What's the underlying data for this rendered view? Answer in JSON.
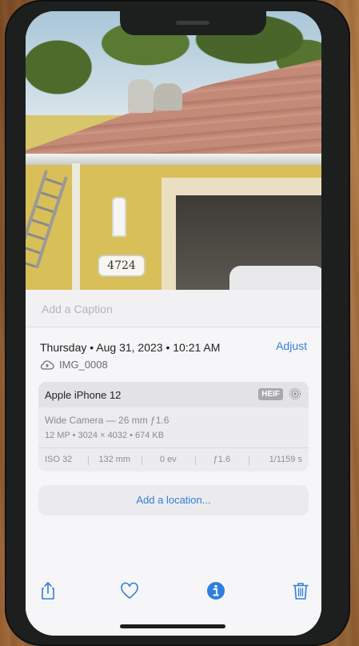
{
  "photo": {
    "house_number": "4724"
  },
  "caption": {
    "placeholder": "Add a Caption"
  },
  "info": {
    "date_time": "Thursday • Aug 31, 2023 • 10:21 AM",
    "adjust_label": "Adjust",
    "filename": "IMG_0008",
    "file_icon": "cloud-icon"
  },
  "camera_card": {
    "device": "Apple iPhone 12",
    "format_badge": "HEIF",
    "lens": "Wide Camera — 26 mm ƒ1.6",
    "specs": "12 MP • 3024 × 4032 • 674 KB",
    "exif": {
      "iso": "ISO 32",
      "focal_length": "132 mm",
      "exposure": "0 ev",
      "aperture": "ƒ1.6",
      "shutter": "1/1159 s"
    }
  },
  "location": {
    "label": "Add a location..."
  },
  "toolbar": {
    "share_icon": "share-icon",
    "favorite_icon": "heart-icon",
    "info_icon": "info-icon",
    "delete_icon": "trash-icon",
    "accent_color": "#2f7fe0"
  }
}
